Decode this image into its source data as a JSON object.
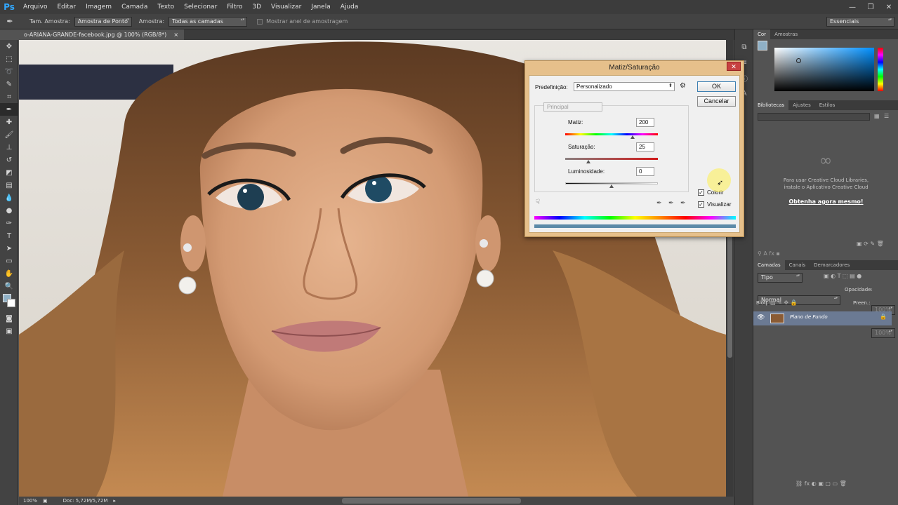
{
  "app": {
    "logo": "Ps"
  },
  "menu": [
    "Arquivo",
    "Editar",
    "Imagem",
    "Camada",
    "Texto",
    "Selecionar",
    "Filtro",
    "3D",
    "Visualizar",
    "Janela",
    "Ajuda"
  ],
  "window_controls": [
    "—",
    "❐",
    "✕"
  ],
  "options_bar": {
    "sample_size_label": "Tam. Amostra:",
    "sample_size_value": "Amostra de Ponto",
    "sample_label": "Amostra:",
    "sample_value": "Todas as camadas",
    "show_ring_label": "Mostrar anel de amostragem",
    "workspace": "Essenciais"
  },
  "document_tab": {
    "title": "o-ARIANA-GRANDE-facebook.jpg @ 100% (RGB/8*)",
    "close": "×"
  },
  "status_bar": {
    "zoom": "100%",
    "doc": "Doc: 5,72M/5,72M"
  },
  "color_panel": {
    "tabs": [
      "Cor",
      "Amostras"
    ],
    "foreground": "#8fb0c6"
  },
  "libraries_panel": {
    "tabs": [
      "Bibliotecas",
      "Ajustes",
      "Estilos"
    ],
    "message_line1": "Para usar Creative Cloud Libraries,",
    "message_line2": "instale o Aplicativo Creative Cloud",
    "link": "Obtenha agora mesmo!"
  },
  "layers_panel": {
    "tabs": [
      "Camadas",
      "Canais",
      "Demarcadores"
    ],
    "filter": "Tipo",
    "blend_mode": "Normal",
    "opacity_label": "Opacidade:",
    "opacity_value": "100%",
    "lock_label": "Bloq.:",
    "fill_label": "Preen.:",
    "fill_value": "100%",
    "layer_name": "Plano de Fundo"
  },
  "dialog": {
    "title": "Matiz/Saturação",
    "close": "✕",
    "preset_label": "Predefinição:",
    "preset_value": "Personalizado",
    "ok": "OK",
    "cancel": "Cancelar",
    "channel": "Principal",
    "hue_label": "Matiz:",
    "hue_value": "200",
    "saturation_label": "Saturação:",
    "saturation_value": "25",
    "lightness_label": "Luminosidade:",
    "lightness_value": "0",
    "colorize_label": "Colorir",
    "colorize_checked": true,
    "preview_label": "Visualizar",
    "preview_checked": true,
    "hue_slider": 0.73,
    "saturation_slider": 0.25,
    "lightness_slider": 0.5
  }
}
